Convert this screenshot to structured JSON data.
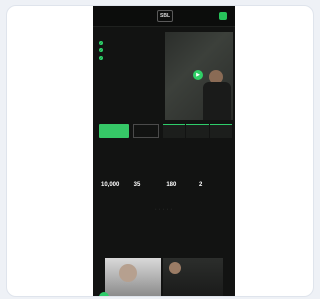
{
  "site": {
    "logo_text": "SBL"
  },
  "hero": {
    "kicker": "",
    "headline": "",
    "subtext": "",
    "bullets": [
      {
        "text": ""
      },
      {
        "text": ""
      },
      {
        "text": ""
      }
    ],
    "cta_primary": "",
    "cta_secondary": "",
    "image_graffiti": [
      "",
      ""
    ],
    "stat_cards": [
      {
        "value": "",
        "label": ""
      },
      {
        "value": "",
        "label": ""
      },
      {
        "value": "",
        "label": ""
      }
    ]
  },
  "stats_section": {
    "title_prefix": "",
    "title_highlight": "",
    "subtitle": "",
    "stats": [
      {
        "value": "10,000",
        "label": ""
      },
      {
        "value": "35",
        "label": ""
      },
      {
        "value": "180",
        "label": ""
      },
      {
        "value": "2",
        "label": ""
      }
    ],
    "dots": "• • • • •"
  },
  "lower_section": {
    "title": ""
  },
  "thumbnails": [
    {
      "caption": ""
    },
    {
      "caption": ""
    }
  ],
  "colors": {
    "accent": "#2ecc6a",
    "background": "#121312",
    "frame": "#eef1f6"
  }
}
